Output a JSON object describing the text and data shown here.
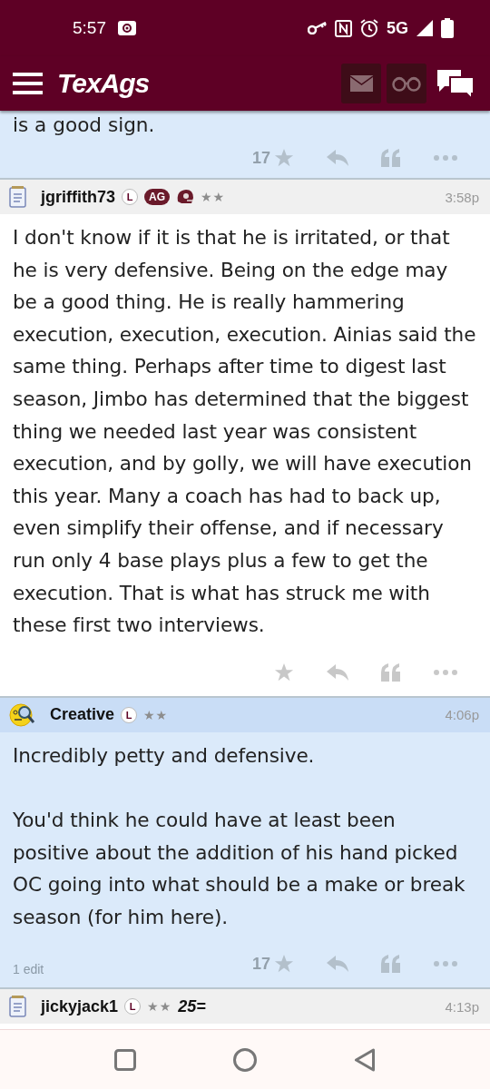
{
  "status_bar": {
    "time": "5:57",
    "network": "5G"
  },
  "header": {
    "logo": "TexAgs"
  },
  "posts": [
    {
      "kind": "tail",
      "highlighted": true,
      "body": "is a good sign.",
      "rating": "17"
    },
    {
      "kind": "full",
      "highlighted": false,
      "author": "jgriffith73",
      "avatar": {
        "kind": "notepad"
      },
      "badges": [
        {
          "kind": "letter",
          "text": "L"
        },
        {
          "kind": "pill",
          "text": "AG"
        },
        {
          "kind": "helmet"
        }
      ],
      "rank": "★★",
      "time": "3:58p",
      "body": "I don't know if it is that he is irritated, or that he is very defensive. Being on the edge may be a good thing. He is really hammering execution, execution, execution. Ainias said the same thing. Perhaps after time to digest last season, Jimbo has determined that the biggest thing we needed last year was consistent execution, and by golly, we will have execution this year. Many a coach has had to back up, even simplify their offense, and if necessary run only 4 base plays plus a few to get the execution. That is what has struck me with these first two interviews."
    },
    {
      "kind": "full",
      "highlighted": true,
      "author": "Creative",
      "avatar": {
        "kind": "emoji"
      },
      "badges": [
        {
          "kind": "letter",
          "text": "L"
        }
      ],
      "rank": "★★",
      "time": "4:06p",
      "body": "Incredibly petty and defensive.\n\nYou'd think he could have at least been positive about the addition of his hand picked OC going into what should be a make or break season (for him here).",
      "edits": "1 edit",
      "rating": "17"
    },
    {
      "kind": "header",
      "highlighted": false,
      "author": "jickyjack1",
      "avatar": {
        "kind": "notepad"
      },
      "badges": [
        {
          "kind": "letter",
          "text": "L"
        }
      ],
      "rank": "★★",
      "extra": "25=",
      "time": "4:13p"
    }
  ]
}
